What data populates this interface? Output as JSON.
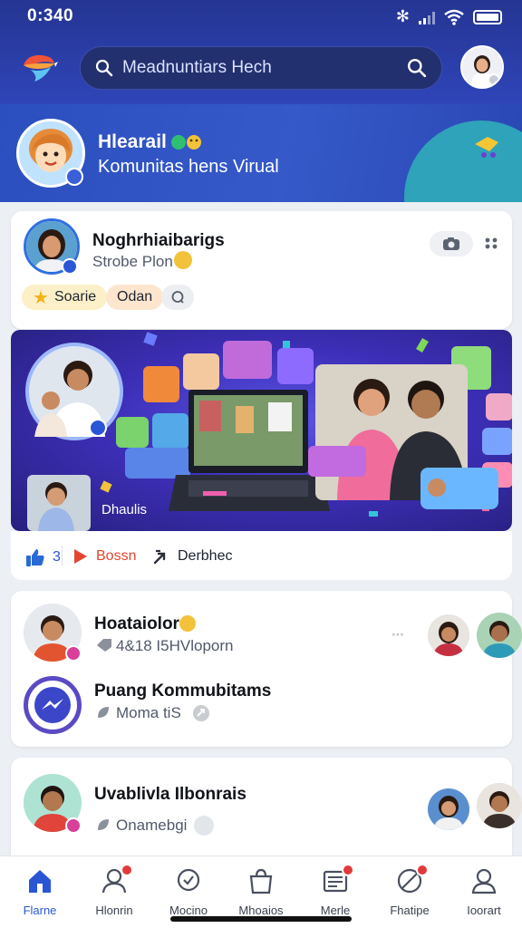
{
  "status_bar": {
    "time": "0:340"
  },
  "header": {
    "search_text": "Meadnuntiars Hech",
    "icons": [
      "app-logo-icon",
      "search-icon",
      "search-icon",
      "avatar"
    ]
  },
  "banner": {
    "title": "Hlearail",
    "subtitle": "Komunitas hens Virual"
  },
  "post": {
    "author": "Noghrhiaibarigs",
    "meta": "Strobe Plon",
    "chips": [
      "Soarie",
      "Odan"
    ],
    "image_caption": "Dhaulis",
    "actions": {
      "like_count": "3",
      "share_label": "Bossn",
      "third_label": "Derbhec"
    }
  },
  "list": [
    {
      "name": "Hoataiolor",
      "meta": "4&18 I5HVloporn"
    },
    {
      "name": "Puang Kommubitams",
      "meta": "Moma tiS"
    },
    {
      "name": "Uvablivla Ilbonrais",
      "meta": "Onamebgi"
    }
  ],
  "tabs": [
    {
      "label": "Flarne",
      "active": true,
      "notif": false
    },
    {
      "label": "Hlonrin",
      "active": false,
      "notif": true
    },
    {
      "label": "Mocino",
      "active": false,
      "notif": false
    },
    {
      "label": "Mhoaios",
      "active": false,
      "notif": false
    },
    {
      "label": "Merle",
      "active": false,
      "notif": true
    },
    {
      "label": "Fhatipe",
      "active": false,
      "notif": true
    },
    {
      "label": "Ioorart",
      "active": false,
      "notif": false
    }
  ],
  "colors": {
    "header": "#253593",
    "accent": "#2a56d6",
    "badge": "#e23a3a"
  }
}
